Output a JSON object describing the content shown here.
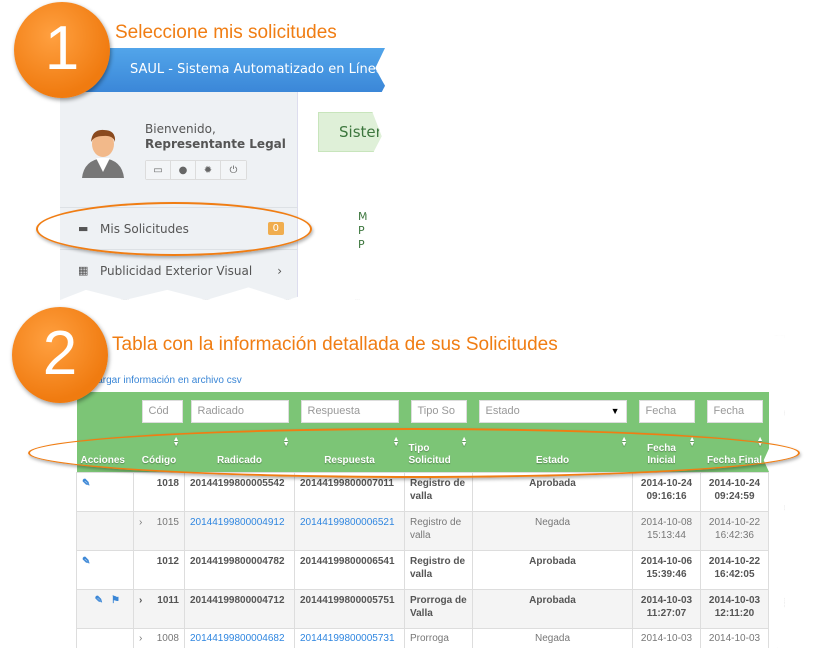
{
  "steps": [
    {
      "number": "1",
      "text": "Seleccione mis solicitudes"
    },
    {
      "number": "2",
      "text": "Tabla con la información detallada de sus Solicitudes"
    }
  ],
  "app": {
    "title": "SAUL - Sistema Automatizado en Línea de"
  },
  "user": {
    "greeting": "Bienvenido,",
    "name": "Representante Legal"
  },
  "user_buttons": [
    "inbox-icon",
    "user-icon",
    "gear-icon",
    "power-icon"
  ],
  "menu": [
    {
      "label": "Mis Solicitudes",
      "badge": "0",
      "icon": "inbox-icon"
    },
    {
      "label": "Publicidad Exterior Visual",
      "icon": "grid-icon",
      "chevron": "›"
    }
  ],
  "main": {
    "card_title": "Sistem",
    "partial_lines": [
      "M",
      "P",
      "P"
    ]
  },
  "table": {
    "csv_link": "Cargar información en archivo csv",
    "filters": {
      "codigo": "Cód",
      "radicado": "Radicado",
      "respuesta": "Respuesta",
      "tipo": "Tipo So",
      "estado": "Estado",
      "fecha_inicial": "Fecha",
      "fecha_final": "Fecha"
    },
    "headers": [
      "Acciones",
      "Código",
      "Radicado",
      "Respuesta",
      "Tipo Solicitud",
      "Estado",
      "Fecha Inicial",
      "Fecha Final"
    ],
    "rows": [
      {
        "actions": [
          "edit"
        ],
        "expand": "",
        "codigo": "1018",
        "radicado": "20144199800005542",
        "respuesta": "20144199800007011",
        "tipo": "Registro de valla",
        "estado": "Aprobada",
        "fi": "2014-10-24 09:16:16",
        "ff": "2014-10-24 09:24:59",
        "bold": true
      },
      {
        "actions": [],
        "expand": "›",
        "codigo": "1015",
        "radicado": "20144199800004912",
        "respuesta": "20144199800006521",
        "tipo": "Registro de valla",
        "estado": "Negada",
        "fi": "2014-10-08 15:13:44",
        "ff": "2014-10-22 16:42:36",
        "bold": false
      },
      {
        "actions": [
          "edit"
        ],
        "expand": "",
        "codigo": "1012",
        "radicado": "20144199800004782",
        "respuesta": "20144199800006541",
        "tipo": "Registro de valla",
        "estado": "Aprobada",
        "fi": "2014-10-06 15:39:46",
        "ff": "2014-10-22 16:42:05",
        "bold": true
      },
      {
        "actions": [
          "edit",
          "flag"
        ],
        "expand": "›",
        "codigo": "1011",
        "radicado": "20144199800004712",
        "respuesta": "20144199800005751",
        "tipo": "Prorroga de Valla",
        "estado": "Aprobada",
        "fi": "2014-10-03 11:27:07",
        "ff": "2014-10-03 12:11:20",
        "bold": true
      },
      {
        "actions": [],
        "expand": "›",
        "codigo": "1008",
        "radicado": "20144199800004682",
        "respuesta": "20144199800005731",
        "tipo": "Prorroga",
        "estado": "Negada",
        "fi": "2014-10-03",
        "ff": "2014-10-03",
        "bold": false
      }
    ]
  },
  "colors": {
    "accent": "#f07d13",
    "header_blue": "#3b87d8",
    "table_green": "#7cc576",
    "link": "#2f86e0"
  }
}
